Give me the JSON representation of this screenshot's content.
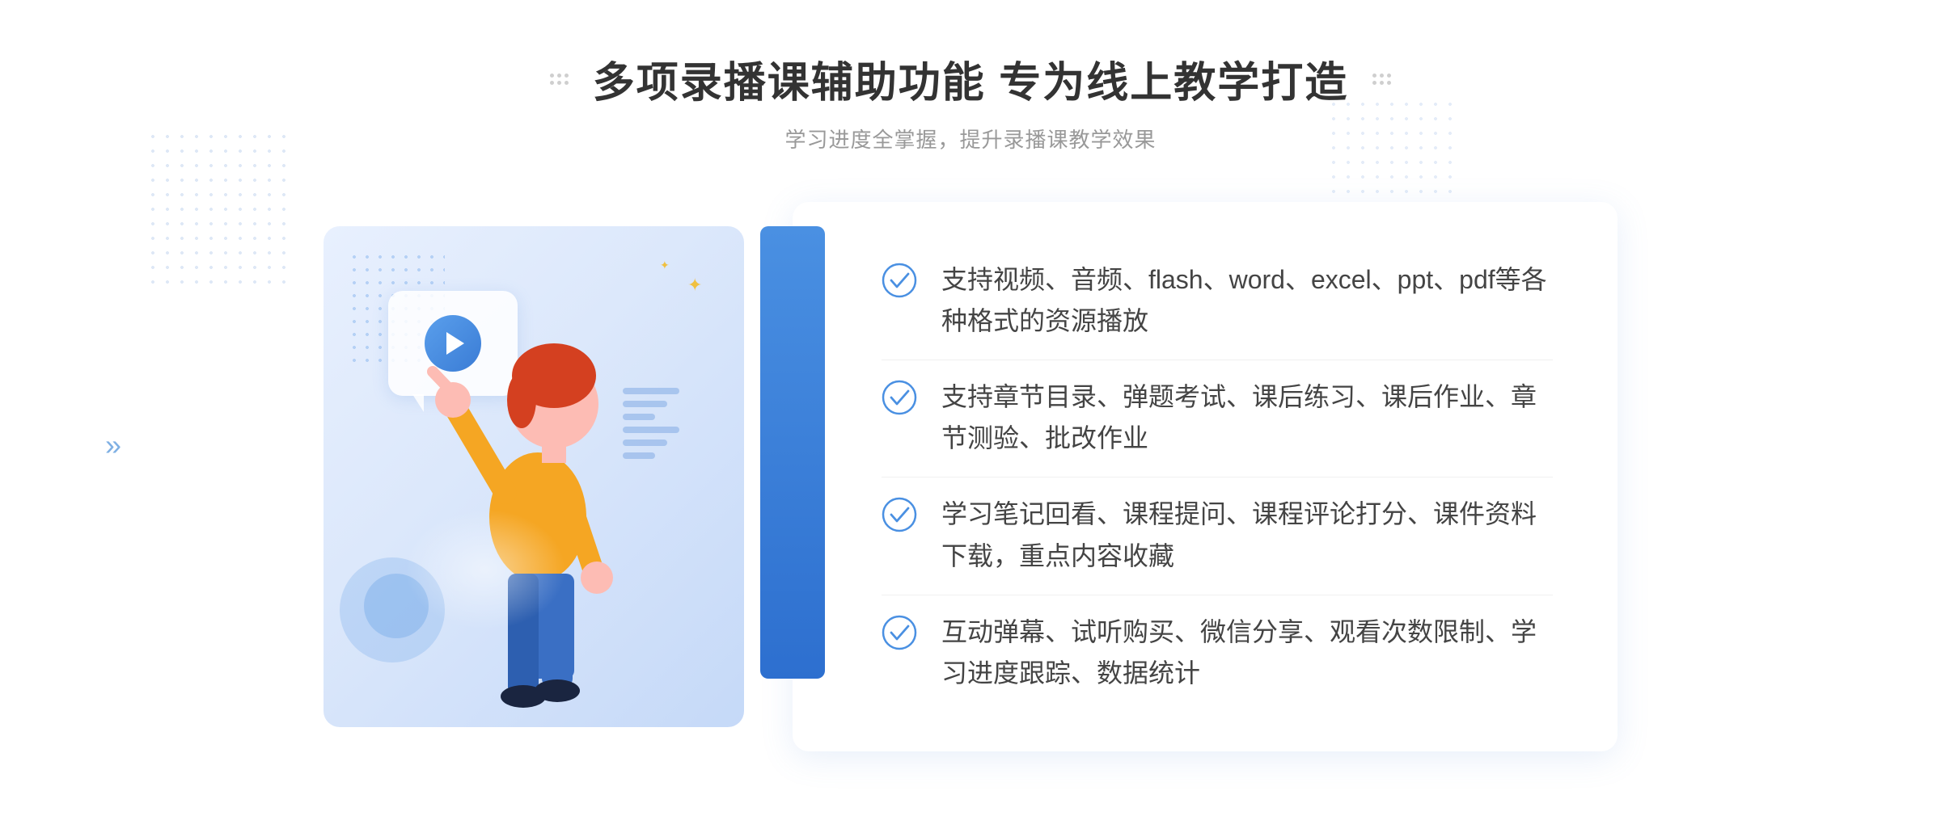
{
  "header": {
    "title": "多项录播课辅助功能 专为线上教学打造",
    "subtitle": "学习进度全掌握，提升录播课教学效果"
  },
  "features": [
    {
      "id": "feature-1",
      "text": "支持视频、音频、flash、word、excel、ppt、pdf等各种格式的资源播放"
    },
    {
      "id": "feature-2",
      "text": "支持章节目录、弹题考试、课后练习、课后作业、章节测验、批改作业"
    },
    {
      "id": "feature-3",
      "text": "学习笔记回看、课程提问、课程评论打分、课件资料下载，重点内容收藏"
    },
    {
      "id": "feature-4",
      "text": "互动弹幕、试听购买、微信分享、观看次数限制、学习进度跟踪、数据统计"
    }
  ],
  "icons": {
    "check": "check-circle-icon",
    "play": "play-button-icon"
  },
  "colors": {
    "primary": "#4a90e2",
    "secondary": "#2d6fcf",
    "text_main": "#333333",
    "text_light": "#999999",
    "check_color": "#4a90e2"
  }
}
